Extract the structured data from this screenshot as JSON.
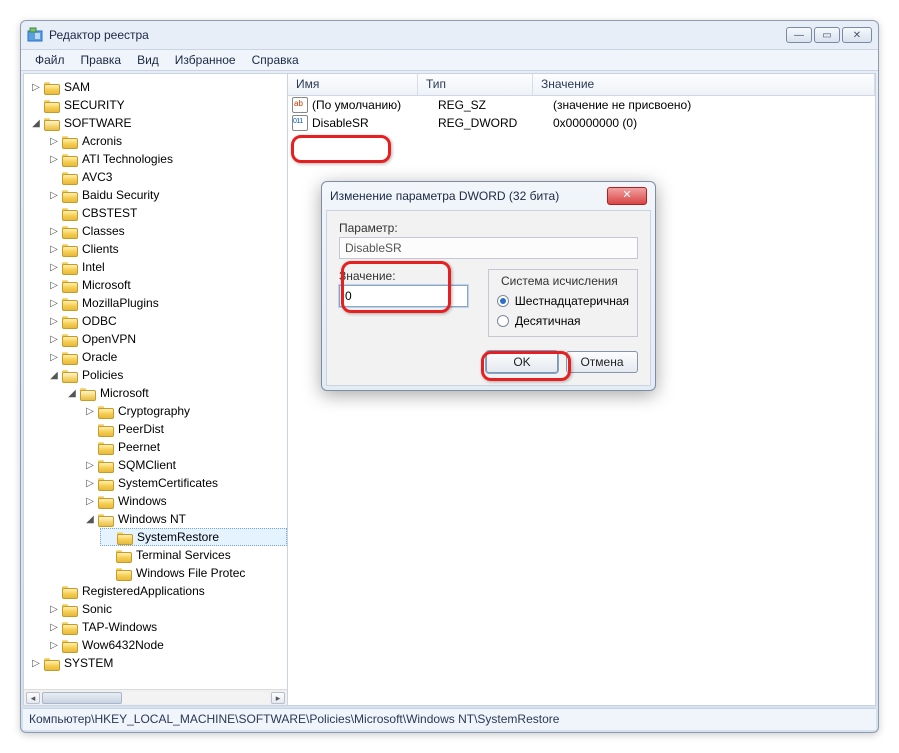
{
  "window": {
    "title": "Редактор реестра",
    "min_tooltip": "Свернуть",
    "max_tooltip": "Развернуть",
    "close_tooltip": "Закрыть"
  },
  "menu": {
    "file": "Файл",
    "edit": "Правка",
    "view": "Вид",
    "favorites": "Избранное",
    "help": "Справка"
  },
  "columns": {
    "name": "Имя",
    "type": "Тип",
    "value": "Значение"
  },
  "rows": {
    "default_name": "(По умолчанию)",
    "default_type": "REG_SZ",
    "default_value": "(значение не присвоено)",
    "disable_name": "DisableSR",
    "disable_type": "REG_DWORD",
    "disable_value": "0x00000000 (0)"
  },
  "tree": {
    "sam": "SAM",
    "security": "SECURITY",
    "software": "SOFTWARE",
    "acronis": "Acronis",
    "ati": "ATI Technologies",
    "avc3": "AVC3",
    "baidu": "Baidu Security",
    "cbstest": "CBSTEST",
    "classes": "Classes",
    "clients": "Clients",
    "intel": "Intel",
    "microsoft": "Microsoft",
    "mozilla": "MozillaPlugins",
    "odbc": "ODBC",
    "openvpn": "OpenVPN",
    "oracle": "Oracle",
    "policies": "Policies",
    "ms2": "Microsoft",
    "crypto": "Cryptography",
    "peerdist": "PeerDist",
    "peernet": "Peernet",
    "sqm": "SQMClient",
    "syscert": "SystemCertificates",
    "windows": "Windows",
    "winnt": "Windows NT",
    "sysrestore": "SystemRestore",
    "terminal": "Terminal Services",
    "wfp": "Windows File Protec",
    "regapps": "RegisteredApplications",
    "sonic": "Sonic",
    "tapwin": "TAP-Windows",
    "wow64": "Wow6432Node",
    "system": "SYSTEM"
  },
  "dialog": {
    "title": "Изменение параметра DWORD (32 бита)",
    "param_label": "Параметр:",
    "param_value": "DisableSR",
    "value_label": "Значение:",
    "value_input": "0",
    "radix_label": "Система исчисления",
    "hex": "Шестнадцатеричная",
    "dec": "Десятичная",
    "ok": "OK",
    "cancel": "Отмена"
  },
  "statusbar": "Компьютер\\HKEY_LOCAL_MACHINE\\SOFTWARE\\Policies\\Microsoft\\Windows NT\\SystemRestore"
}
